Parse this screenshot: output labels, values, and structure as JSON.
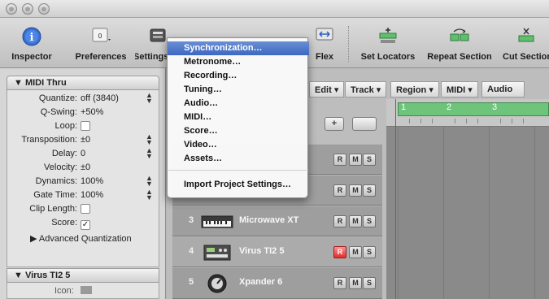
{
  "toolbar": {
    "inspector_label": "Inspector",
    "preferences_label": "Preferences",
    "settings_label": "Settings",
    "flex_label": "Flex",
    "set_locators_label": "Set Locators",
    "repeat_section_label": "Repeat Section",
    "cut_section_label": "Cut Section",
    "preferences_icon_text": "0",
    "inspector_icon_glyph": "i"
  },
  "settings_menu": {
    "items": [
      "Synchronization…",
      "Metronome…",
      "Recording…",
      "Tuning…",
      "Audio…",
      "MIDI…",
      "Score…",
      "Video…",
      "Assets…",
      "Import Project Settings…"
    ],
    "highlighted_index": 0
  },
  "inspector": {
    "region_header": "▼ MIDI Thru",
    "rows": [
      {
        "label": "Quantize:",
        "value": "off (3840)",
        "stepper": true
      },
      {
        "label": "Q-Swing:",
        "value": "+50%",
        "stepper": false
      },
      {
        "label": "Loop:",
        "value": "",
        "checkbox": true,
        "checked": false
      },
      {
        "label": "Transposition:",
        "value": "±0",
        "stepper": true
      },
      {
        "label": "Delay:",
        "value": "0",
        "stepper": true
      },
      {
        "label": "Velocity:",
        "value": "±0",
        "stepper": false
      },
      {
        "label": "Dynamics:",
        "value": "100%",
        "stepper": true
      },
      {
        "label": "Gate Time:",
        "value": "100%",
        "stepper": true
      },
      {
        "label": "Clip Length:",
        "value": "",
        "checkbox": true,
        "checked": false
      },
      {
        "label": "Score:",
        "value": "",
        "checkbox": true,
        "checked": true
      }
    ],
    "advanced_quantization": "▶ Advanced Quantization",
    "track_header": "▼ Virus TI2  5",
    "icon_label": "Icon:"
  },
  "local_menu": [
    "Edit",
    "Track",
    "Region",
    "MIDI",
    "Audio"
  ],
  "tracks": [
    {
      "num": "3",
      "name": "Microwave XT",
      "record_on": false
    },
    {
      "num": "4",
      "name": "Virus TI2  5",
      "record_on": true
    },
    {
      "num": "5",
      "name": "Xpander  6",
      "record_on": false
    }
  ],
  "track_buttons": {
    "record": "R",
    "mute": "M",
    "solo": "S"
  },
  "ruler": {
    "bars": [
      "1",
      "2",
      "3"
    ]
  },
  "colors": {
    "cycle": "#6fc47c",
    "highlight": "#3d67c2",
    "record_on": "#e52b2b"
  }
}
